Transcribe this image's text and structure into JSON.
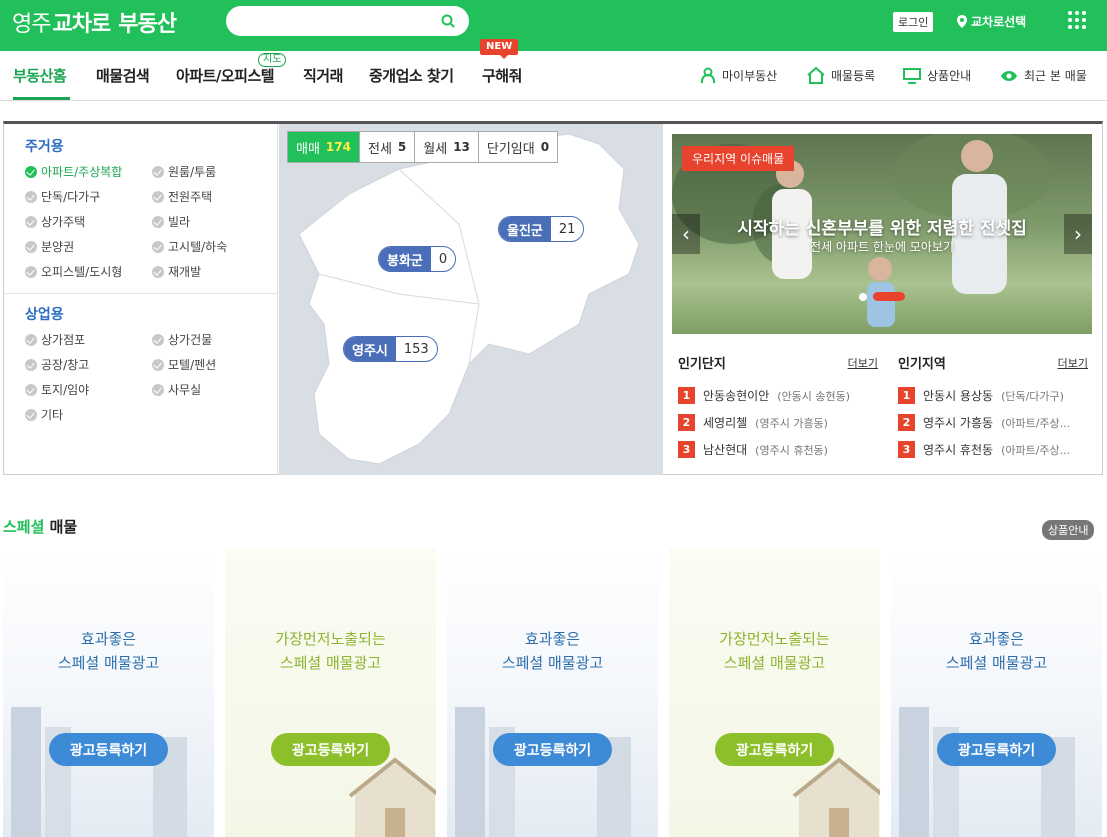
{
  "brand": {
    "part1": "영주",
    "part2": "교차로",
    "part3": "부동산"
  },
  "header": {
    "login_label": "로그인",
    "region_label": "교차로선택"
  },
  "nav": {
    "items": [
      "부동산홈",
      "매물검색",
      "아파트/오피스텔",
      "직거래",
      "중개업소 찾기",
      "구해줘"
    ],
    "map_tag": "지도",
    "new_tag": "NEW",
    "right": [
      "마이부동산",
      "매물등록",
      "상품안내",
      "최근 본 매물"
    ]
  },
  "categories": {
    "residential_title": "주거용",
    "residential": [
      "아파트/주상복합",
      "원룸/투룸",
      "단독/다가구",
      "전원주택",
      "상가주택",
      "빌라",
      "분양권",
      "고시텔/하숙",
      "오피스텔/도시형",
      "재개발"
    ],
    "commercial_title": "상업용",
    "commercial": [
      "상가점포",
      "상가건물",
      "공장/창고",
      "모텔/펜션",
      "토지/임야",
      "사무실",
      "기타"
    ]
  },
  "deals": [
    {
      "label": "매매",
      "count": "174"
    },
    {
      "label": "전세",
      "count": "5"
    },
    {
      "label": "월세",
      "count": "13"
    },
    {
      "label": "단기임대",
      "count": "0"
    }
  ],
  "map_regions": [
    {
      "name": "울진군",
      "count": "21"
    },
    {
      "name": "봉화군",
      "count": "0"
    },
    {
      "name": "영주시",
      "count": "153"
    }
  ],
  "banner": {
    "tag": "우리지역 이슈매물",
    "title": "시작하는 신혼부부를 위한 저렴한 전셋집",
    "subtitle": "전세 아파트 한눈에 모아보기"
  },
  "popular_complex": {
    "title": "인기단지",
    "more": "더보기",
    "items": [
      {
        "rank": "1",
        "name": "안동송현이안",
        "sub": "(안동시 송현동)"
      },
      {
        "rank": "2",
        "name": "세영리첼",
        "sub": "(영주시 가흥동)"
      },
      {
        "rank": "3",
        "name": "남산현대",
        "sub": "(영주시 휴천동)"
      }
    ]
  },
  "popular_region": {
    "title": "인기지역",
    "more": "더보기",
    "items": [
      {
        "rank": "1",
        "name": "안동시 용상동",
        "sub": "(단독/다가구)"
      },
      {
        "rank": "2",
        "name": "영주시 가흥동",
        "sub": "(아파트/주상..."
      },
      {
        "rank": "3",
        "name": "영주시 휴천동",
        "sub": "(아파트/주상..."
      }
    ]
  },
  "special": {
    "title_green": "스페셜",
    "title_rest": " 매물",
    "product_info": "상품안내",
    "cards": [
      {
        "line1": "효과좋은",
        "line2": "스페셜 매물광고",
        "button": "광고등록하기"
      },
      {
        "line1": "가장먼저노출되는",
        "line2": "스페셜 매물광고",
        "button": "광고등록하기"
      },
      {
        "line1": "효과좋은",
        "line2": "스페셜 매물광고",
        "button": "광고등록하기"
      },
      {
        "line1": "가장먼저노출되는",
        "line2": "스페셜 매물광고",
        "button": "광고등록하기"
      },
      {
        "line1": "효과좋은",
        "line2": "스페셜 매물광고",
        "button": "광고등록하기"
      }
    ]
  },
  "colors": {
    "brand_green": "#22c05a",
    "accent_red": "#e8432d",
    "pin_blue": "#4a6fb8"
  }
}
